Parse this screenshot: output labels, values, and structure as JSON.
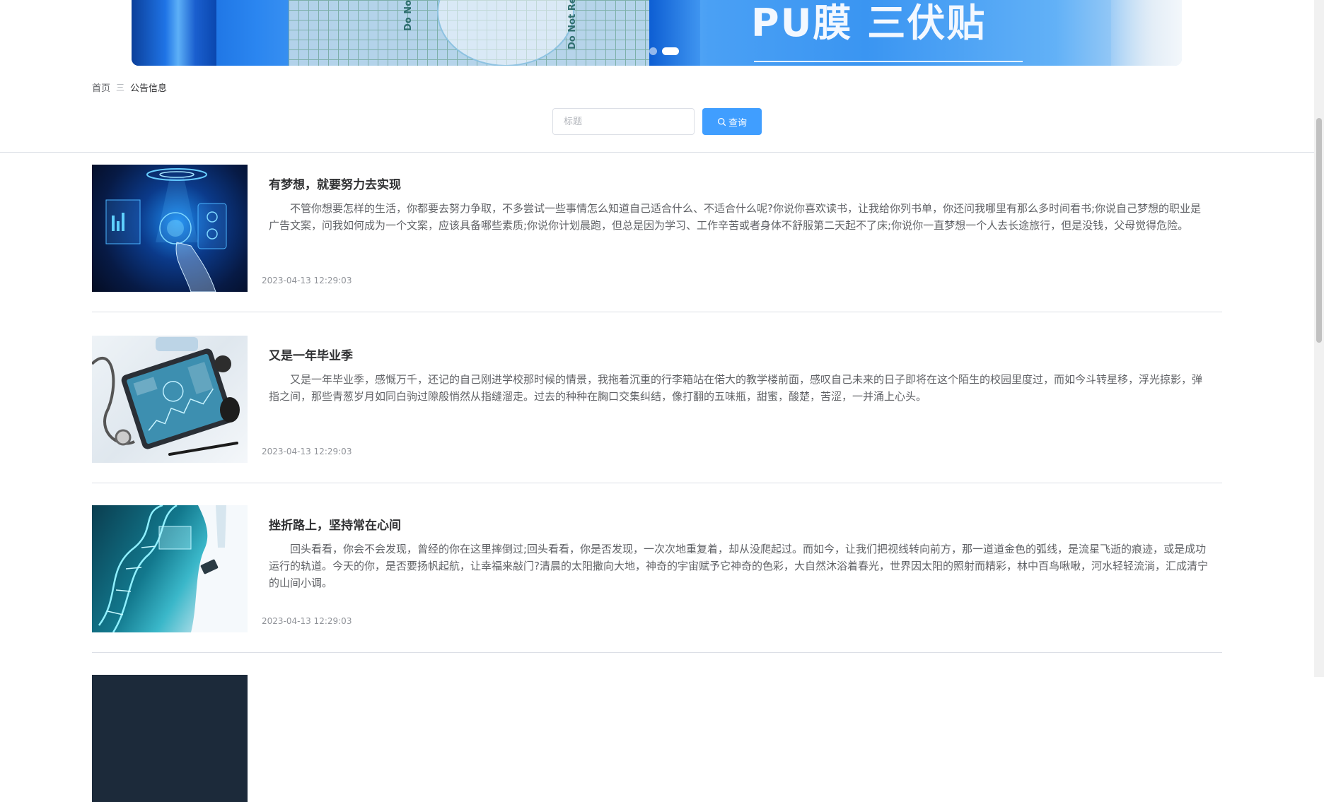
{
  "banner": {
    "title": "PU膜 三伏贴",
    "pack_text": "Do Not Reuse",
    "slide_count": 2,
    "active_slide": 2
  },
  "breadcrumb": {
    "home": "首页",
    "separator": "三",
    "current": "公告信息"
  },
  "search": {
    "placeholder": "标题",
    "button_label": "查询"
  },
  "articles": [
    {
      "title": "有梦想，就要努力去实现",
      "body": "不管你想要怎样的生活，你都要去努力争取，不多尝试一些事情怎么知道自己适合什么、不适合什么呢?你说你喜欢读书，让我给你列书单，你还问我哪里有那么多时间看书;你说自己梦想的职业是广告文案，问我如何成为一个文案，应该具备哪些素质;你说你计划晨跑，但总是因为学习、工作辛苦或者身体不舒服第二天起不了床;你说你一直梦想一个人去长途旅行，但是没钱，父母觉得危险。",
      "date": "2023-04-13 12:29:03"
    },
    {
      "title": "又是一年毕业季",
      "body": "又是一年毕业季，感慨万千，还记的自己刚进学校那时候的情景，我拖着沉重的行李箱站在偌大的教学楼前面，感叹自己未来的日子即将在这个陌生的校园里度过，而如今斗转星移，浮光掠影，弹指之间，那些青葱岁月如同白驹过隙般悄然从指缝溜走。过去的种种在胸口交集纠结，像打翻的五味瓶，甜蜜，酸楚，苦涩，一并涌上心头。",
      "date": "2023-04-13 12:29:03"
    },
    {
      "title": "挫折路上，坚持常在心间",
      "body": "回头看看，你会不会发现，曾经的你在这里摔倒过;回头看看，你是否发现，一次次地重复着，却从没爬起过。而如今，让我们把视线转向前方，那一道道金色的弧线，是流星飞逝的痕迹，或是成功运行的轨道。今天的你，是否要扬帆起航，让幸福来敲门?清晨的太阳撒向大地，神奇的宇宙赋予它神奇的色彩，大自然沐浴着春光，世界因太阳的照射而精彩，林中百鸟啾啾，河水轻轻流淌，汇成清宁的山间小调。",
      "date": "2023-04-13 12:29:03"
    }
  ],
  "colors": {
    "primary": "#409eff",
    "divider": "#dcdfe6",
    "text_main": "#303133",
    "text_body": "#606266",
    "text_meta": "#909399"
  }
}
